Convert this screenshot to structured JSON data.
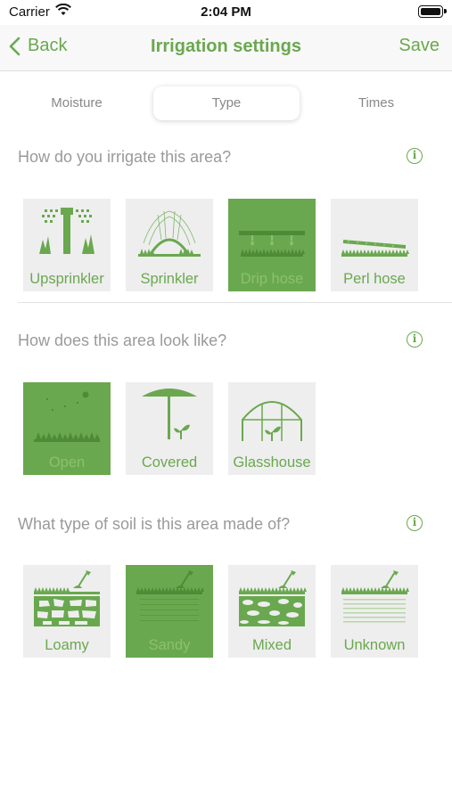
{
  "status": {
    "carrier": "Carrier",
    "time": "2:04 PM"
  },
  "nav": {
    "back_label": "Back",
    "title": "Irrigation settings",
    "save_label": "Save"
  },
  "tabs": [
    {
      "label": "Moisture",
      "selected": false
    },
    {
      "label": "Type",
      "selected": true
    },
    {
      "label": "Times",
      "selected": false
    }
  ],
  "sections": {
    "irrigation": {
      "question": "How do you irrigate this area?",
      "options": [
        {
          "label": "Upsprinkler",
          "selected": false
        },
        {
          "label": "Sprinkler",
          "selected": false
        },
        {
          "label": "Drip hose",
          "selected": true
        },
        {
          "label": "Perl hose",
          "selected": false
        }
      ]
    },
    "look": {
      "question": "How does this area look like?",
      "options": [
        {
          "label": "Open",
          "selected": true
        },
        {
          "label": "Covered",
          "selected": false
        },
        {
          "label": "Glasshouse",
          "selected": false
        }
      ]
    },
    "soil": {
      "question": "What type of soil is this area made of?",
      "options": [
        {
          "label": "Loamy",
          "selected": false
        },
        {
          "label": "Sandy",
          "selected": true
        },
        {
          "label": "Mixed",
          "selected": false
        },
        {
          "label": "Unknown",
          "selected": false
        }
      ]
    }
  },
  "colors": {
    "accent": "#6aa84f",
    "tile_bg": "#eeeeee",
    "muted_text": "#9a9a9a"
  }
}
